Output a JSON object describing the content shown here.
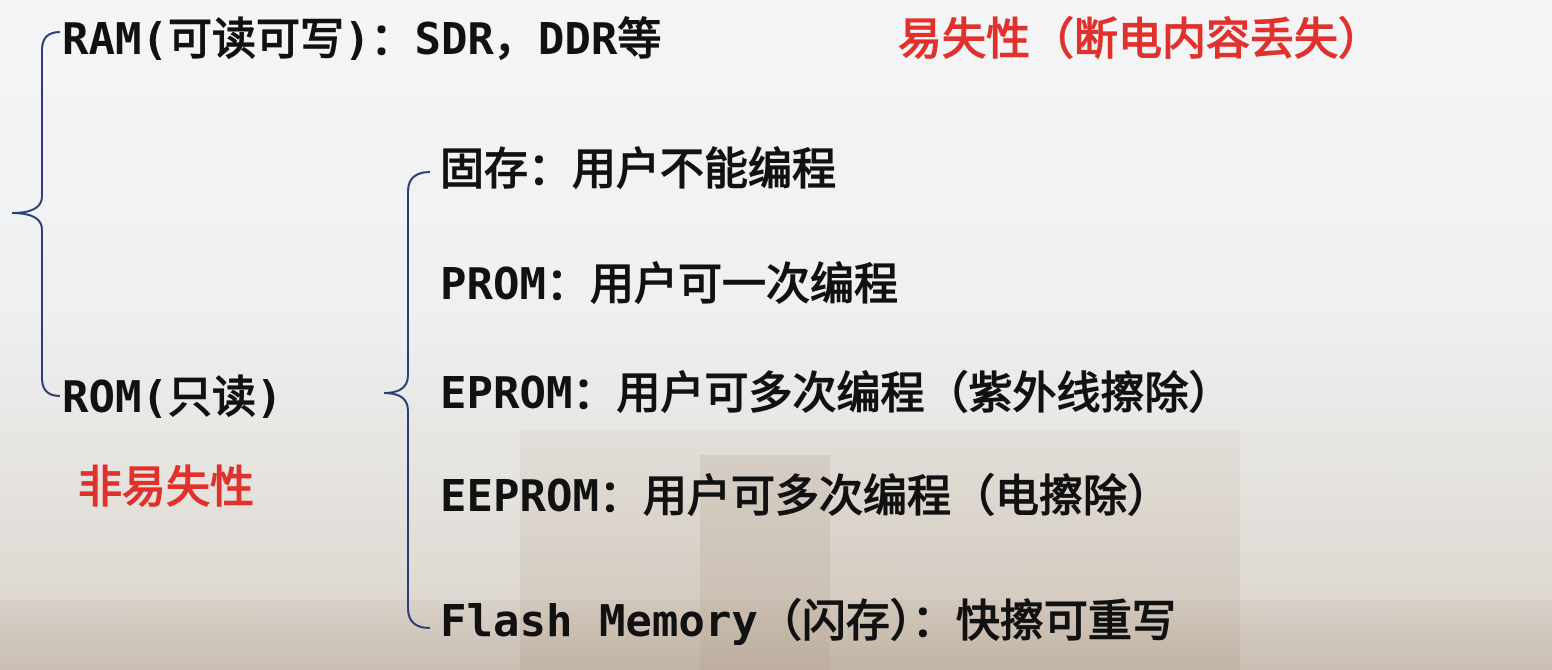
{
  "ram": {
    "label": "RAM(可读可写)：SDR，DDR等",
    "note": "易失性（断电内容丢失）"
  },
  "rom": {
    "label": "ROM(只读)",
    "note": "非易失性",
    "items": [
      "固存：用户不能编程",
      "PROM：用户可一次编程",
      "EPROM：用户可多次编程（紫外线擦除）",
      "EEPROM：用户可多次编程（电擦除）",
      "Flash Memory（闪存）：快擦可重写"
    ]
  },
  "colors": {
    "text": "#111111",
    "accent_red": "#e0312c",
    "brace": "#2c3e73"
  }
}
